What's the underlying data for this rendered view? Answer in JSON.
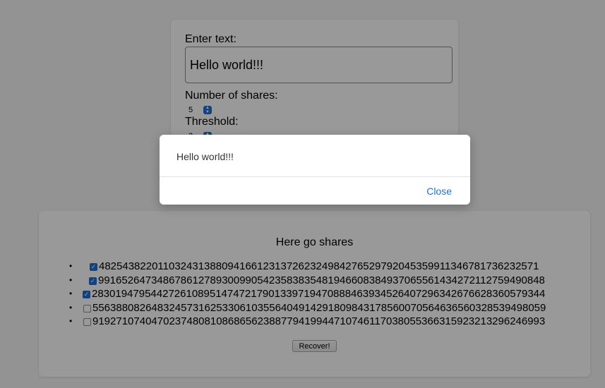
{
  "form": {
    "text_label": "Enter text:",
    "text_value": "Hello world!!!",
    "shares_label": "Number of shares:",
    "shares_value": "5",
    "threshold_label": "Threshold:",
    "threshold_value": "3"
  },
  "shares": {
    "title": "Here go shares",
    "items": [
      {
        "value": "48254382201103243138809416612313726232498427652979204535991134678173623257​1",
        "checked": true
      },
      {
        "value": "9916526473486786127893009905423583835481946608384937065561434272112759490848",
        "checked": true
      },
      {
        "value": "2830194795442726108951474721790133971947088846393452640729634267662836057934​4",
        "checked": true
      },
      {
        "value": "5563880826483245731625330610355640491429180984317856007056463656032853949805​9",
        "checked": false
      },
      {
        "value": "9192710740470237480810868656238877941994471074611703805536631592321329624699​3",
        "checked": false
      }
    ],
    "recover_label": "Recover!"
  },
  "dialog": {
    "message": "Hello world!!!",
    "close_label": "Close"
  },
  "colors": {
    "accent": "#1a73e8",
    "checkbox": "#1f6fd8",
    "overlay": "rgba(0,0,0,0.4)"
  }
}
